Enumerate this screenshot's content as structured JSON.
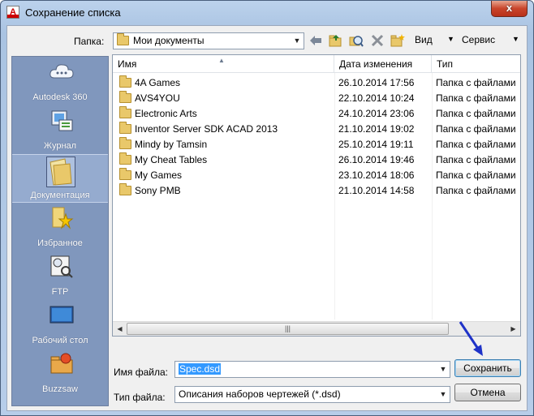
{
  "window": {
    "title": "Сохранение списка",
    "close_glyph": "x",
    "app_icon_letter": "A"
  },
  "toolbar": {
    "folder_label": "Папка:",
    "folder_value": "Мои документы",
    "view_label": "Вид",
    "tools_label": "Сервис",
    "icons": [
      "back-icon",
      "up-folder-icon",
      "search-web-icon",
      "delete-icon",
      "new-folder-icon",
      "view-dropdown-icon",
      "tools-dropdown-icon"
    ]
  },
  "places": [
    {
      "label": "Autodesk 360",
      "icon": "cloud-icon"
    },
    {
      "label": "Журнал",
      "icon": "history-icon"
    },
    {
      "label": "Документация",
      "icon": "documents-folder-icon"
    },
    {
      "label": "Избранное",
      "icon": "favorites-icon"
    },
    {
      "label": "FTP",
      "icon": "ftp-icon"
    },
    {
      "label": "Рабочий стол",
      "icon": "desktop-icon"
    },
    {
      "label": "Buzzsaw",
      "icon": "buzzsaw-icon"
    }
  ],
  "file_list": {
    "columns": [
      "Имя",
      "Дата изменения",
      "Тип"
    ],
    "rows": [
      {
        "name": "4A Games",
        "modified": "26.10.2014 17:56",
        "type": "Папка с файлами"
      },
      {
        "name": "AVS4YOU",
        "modified": "22.10.2014 10:24",
        "type": "Папка с файлами"
      },
      {
        "name": "Electronic Arts",
        "modified": "24.10.2014 23:06",
        "type": "Папка с файлами"
      },
      {
        "name": "Inventor Server SDK ACAD 2013",
        "modified": "21.10.2014 19:02",
        "type": "Папка с файлами"
      },
      {
        "name": "Mindy by Tamsin",
        "modified": "25.10.2014 19:11",
        "type": "Папка с файлами"
      },
      {
        "name": "My Cheat Tables",
        "modified": "26.10.2014 19:46",
        "type": "Папка с файлами"
      },
      {
        "name": "My Games",
        "modified": "23.10.2014 18:06",
        "type": "Папка с файлами"
      },
      {
        "name": "Sony PMB",
        "modified": "21.10.2014 14:58",
        "type": "Папка с файлами"
      }
    ]
  },
  "footer": {
    "filename_label": "Имя файла:",
    "filename_value": "Spec.dsd",
    "filetype_label": "Тип файла:",
    "filetype_value": "Описания наборов чертежей (*.dsd)",
    "save_label": "Сохранить",
    "cancel_label": "Отмена"
  },
  "colors": {
    "places_bg": "#8097bd",
    "title_bar": "#b7cde9",
    "close_button": "#c9452b",
    "selection": "#3399ff",
    "annotation_arrow": "#1f33c8"
  }
}
